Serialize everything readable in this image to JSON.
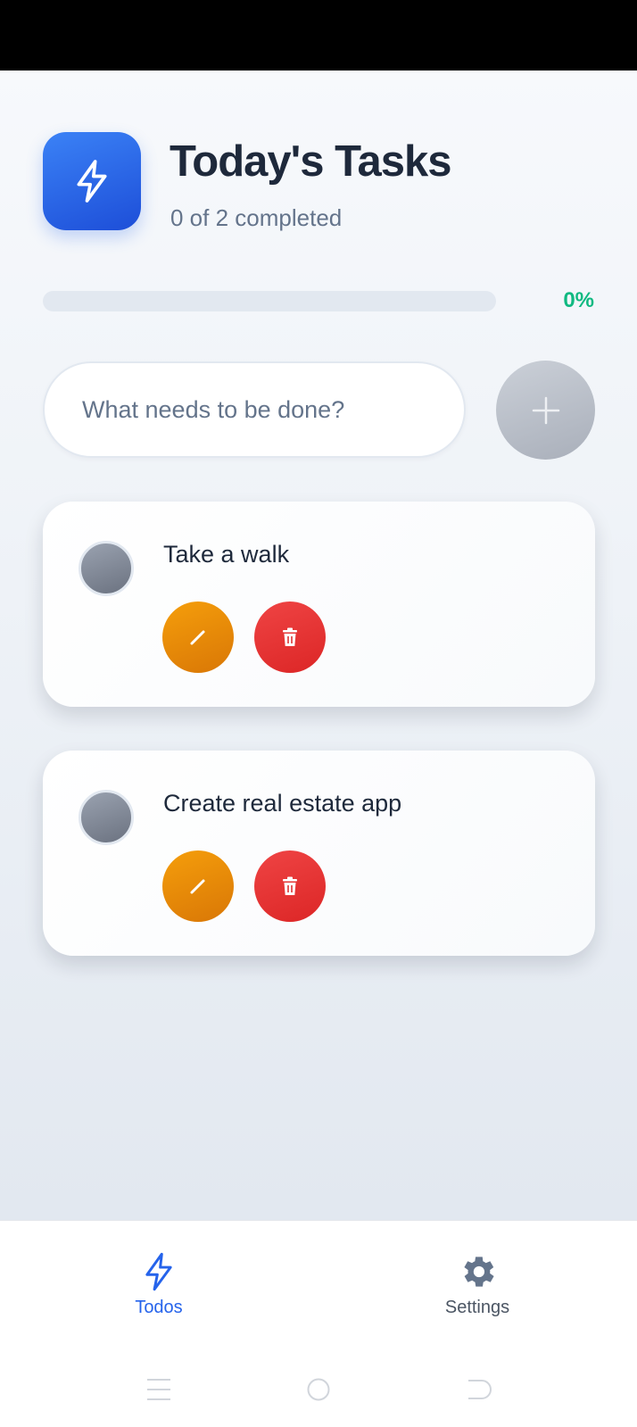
{
  "header": {
    "title": "Today's Tasks",
    "subtitle": "0 of 2 completed"
  },
  "progress": {
    "percent_label": "0%",
    "value": 0
  },
  "new_todo": {
    "placeholder": "What needs to be done?"
  },
  "todos": [
    {
      "text": "Take a walk",
      "completed": false
    },
    {
      "text": "Create real estate app",
      "completed": false
    }
  ],
  "tabs": [
    {
      "label": "Todos",
      "icon": "lightning-icon",
      "active": true
    },
    {
      "label": "Settings",
      "icon": "gear-icon",
      "active": false
    }
  ],
  "colors": {
    "primary": "#2563eb",
    "success": "#10b981",
    "edit": "#f59e0b",
    "delete": "#ef4444",
    "title": "#1e293b",
    "muted": "#64748b"
  }
}
